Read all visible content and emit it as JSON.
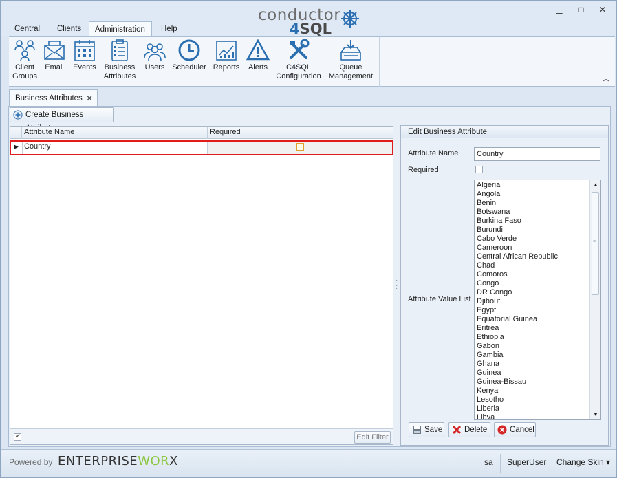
{
  "window": {
    "minimize": "▁",
    "maximize": "□",
    "close": "✕"
  },
  "logo": {
    "line1": "conductor",
    "line2_a": "4",
    "line2_b": "SQL"
  },
  "tabs": [
    "Central",
    "Clients",
    "Administration",
    "Help"
  ],
  "active_tab": "Administration",
  "ribbon": {
    "items": [
      {
        "label": "Client Groups",
        "icon": "client-groups-icon"
      },
      {
        "label": "Email",
        "icon": "email-icon"
      },
      {
        "label": "Events",
        "icon": "calendar-icon"
      },
      {
        "label": "Business Attributes",
        "icon": "clipboard-list-icon"
      },
      {
        "label": "Users",
        "icon": "users-icon"
      },
      {
        "label": "Scheduler",
        "icon": "clock-icon"
      },
      {
        "label": "Reports",
        "icon": "chart-report-icon"
      },
      {
        "label": "Alerts",
        "icon": "warning-icon"
      },
      {
        "label": "C4SQL Configuration",
        "icon": "tools-icon"
      },
      {
        "label": "Queue Management",
        "icon": "inbox-tray-icon"
      }
    ],
    "collapse": "︿"
  },
  "doc_tab": {
    "label": "Business Attributes",
    "close": "✕"
  },
  "create_button": "Create Business Attribute",
  "grid": {
    "columns": [
      "Attribute Name",
      "Required"
    ],
    "rows": [
      {
        "name": "Country",
        "required": false
      }
    ],
    "edit_filter": "Edit Filter"
  },
  "edit_panel": {
    "title": "Edit Business Attribute",
    "name_label": "Attribute Name",
    "name_value": "Country",
    "required_label": "Required",
    "values_label": "Attribute Value List",
    "values": [
      "Algeria",
      "Angola",
      "Benin",
      "Botswana",
      "Burkina Faso",
      "Burundi",
      "Cabo Verde",
      "Cameroon",
      "Central African Republic",
      "Chad",
      "Comoros",
      "Congo",
      "DR Congo",
      "Djibouti",
      "Egypt",
      "Equatorial Guinea",
      "Eritrea",
      "Ethiopia",
      "Gabon",
      "Gambia",
      "Ghana",
      "Guinea",
      "Guinea-Bissau",
      "Kenya",
      "Lesotho",
      "Liberia",
      "Libya"
    ],
    "save": "Save",
    "delete": "Delete",
    "cancel": "Cancel"
  },
  "status": {
    "powered": "Powered by",
    "brand_a": "ENTERPRISE",
    "brand_b": "WOR",
    "brand_c": "X",
    "user": "sa",
    "role": "SuperUser",
    "skin": "Change Skin ▾"
  },
  "colors": {
    "accent": "#2b6fb0",
    "selection_border": "#e01c1c",
    "brand_green": "#8dc63f"
  }
}
